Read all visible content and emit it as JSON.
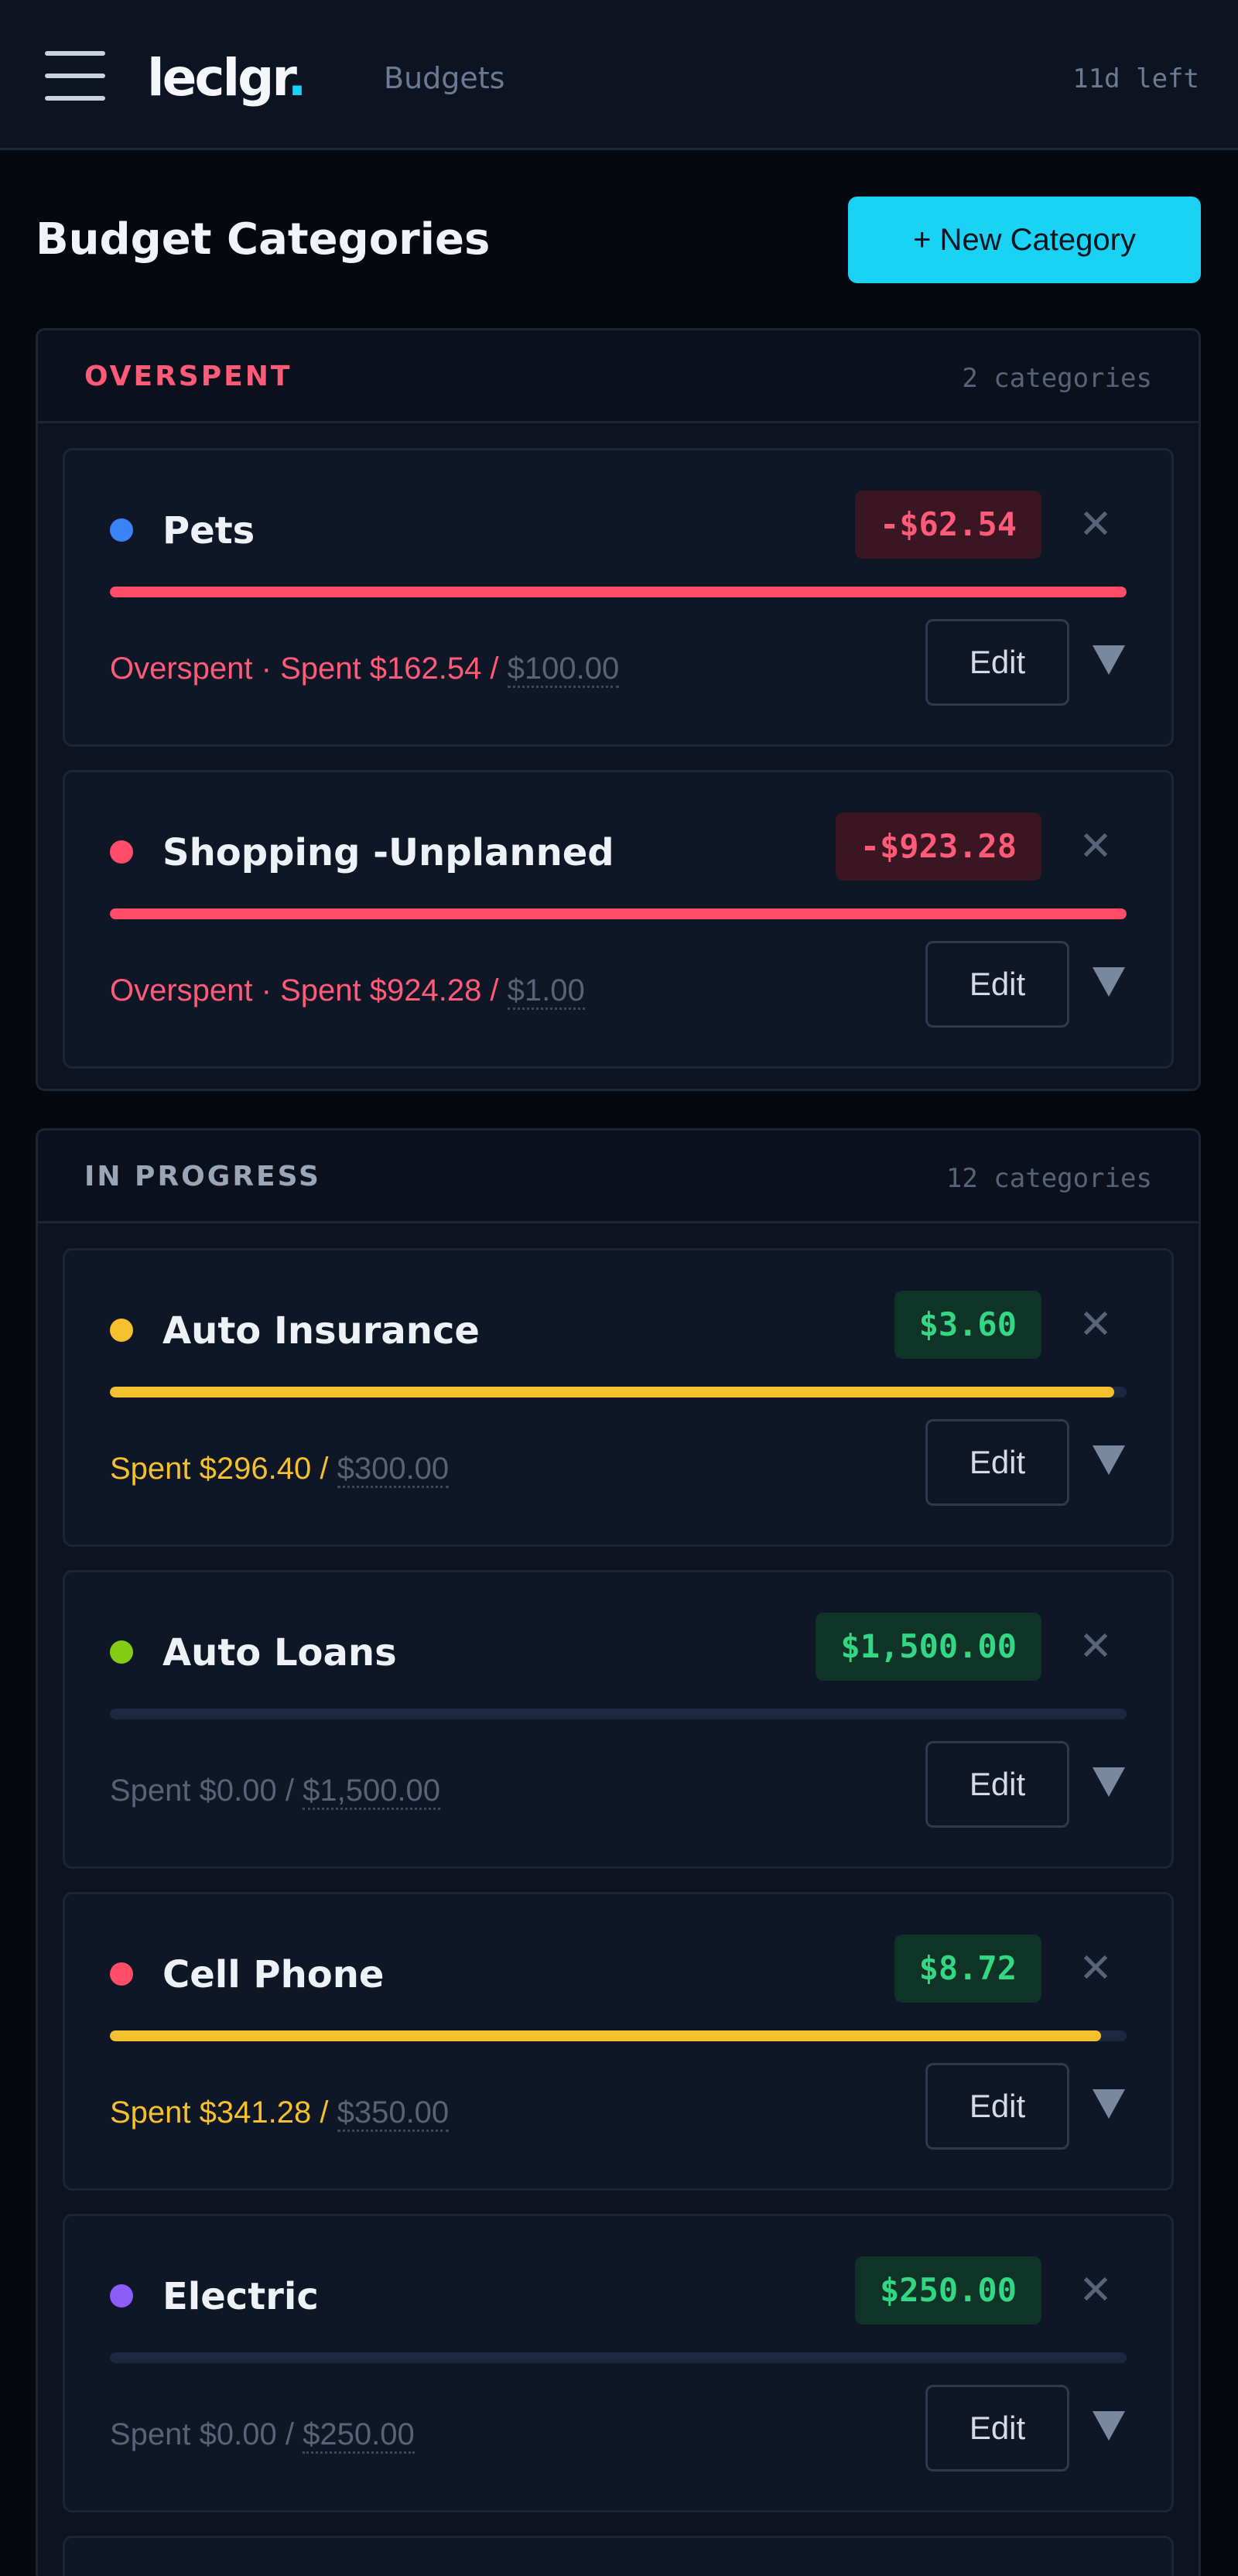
{
  "header": {
    "logo": "leclgr",
    "logo_dot": ".",
    "breadcrumb": "Budgets",
    "days_left": "11d left"
  },
  "page": {
    "title": "Budget Categories",
    "new_button": "+ New Category"
  },
  "groups": [
    {
      "name": "OVERSPENT",
      "count": "2 categories",
      "color": "#ff5a78",
      "items": [
        {
          "name": "Pets",
          "dot_color": "#3b82f6",
          "amount": "-$62.54",
          "status": "Overspent",
          "separator": " · ",
          "spent": "Spent $162.54 / ",
          "budget": "$100.00",
          "progress": 1.0,
          "bar_color": "#ff4d6a",
          "edit": "Edit"
        },
        {
          "name": "Shopping -Unplanned",
          "dot_color": "#ff4d6a",
          "amount": "-$923.28",
          "status": "Overspent",
          "separator": " · ",
          "spent": "Spent $924.28 / ",
          "budget": "$1.00",
          "progress": 1.0,
          "bar_color": "#ff4d6a",
          "edit": "Edit"
        }
      ]
    },
    {
      "name": "IN PROGRESS",
      "count": "12 categories",
      "color": "#9aa6b8",
      "items": [
        {
          "name": "Auto Insurance",
          "dot_color": "#f5c02e",
          "amount": "$3.60",
          "status": "",
          "separator": "",
          "spent": "Spent $296.40 / ",
          "budget": "$300.00",
          "progress": 0.988,
          "bar_color": "#f5c02e",
          "edit": "Edit"
        },
        {
          "name": "Auto Loans",
          "dot_color": "#84cc16",
          "amount": "$1,500.00",
          "status": "",
          "separator": "",
          "spent": "Spent $0.00 / ",
          "budget": "$1,500.00",
          "progress": 0,
          "bar_color": "#f5c02e",
          "edit": "Edit"
        },
        {
          "name": "Cell Phone",
          "dot_color": "#ff4d6a",
          "amount": "$8.72",
          "status": "",
          "separator": "",
          "spent": "Spent $341.28 / ",
          "budget": "$350.00",
          "progress": 0.975,
          "bar_color": "#f5c02e",
          "edit": "Edit"
        },
        {
          "name": "Electric",
          "dot_color": "#8b5cf6",
          "amount": "$250.00",
          "status": "",
          "separator": "",
          "spent": "Spent $0.00 / ",
          "budget": "$250.00",
          "progress": 0,
          "bar_color": "#f5c02e",
          "edit": "Edit"
        }
      ]
    }
  ]
}
